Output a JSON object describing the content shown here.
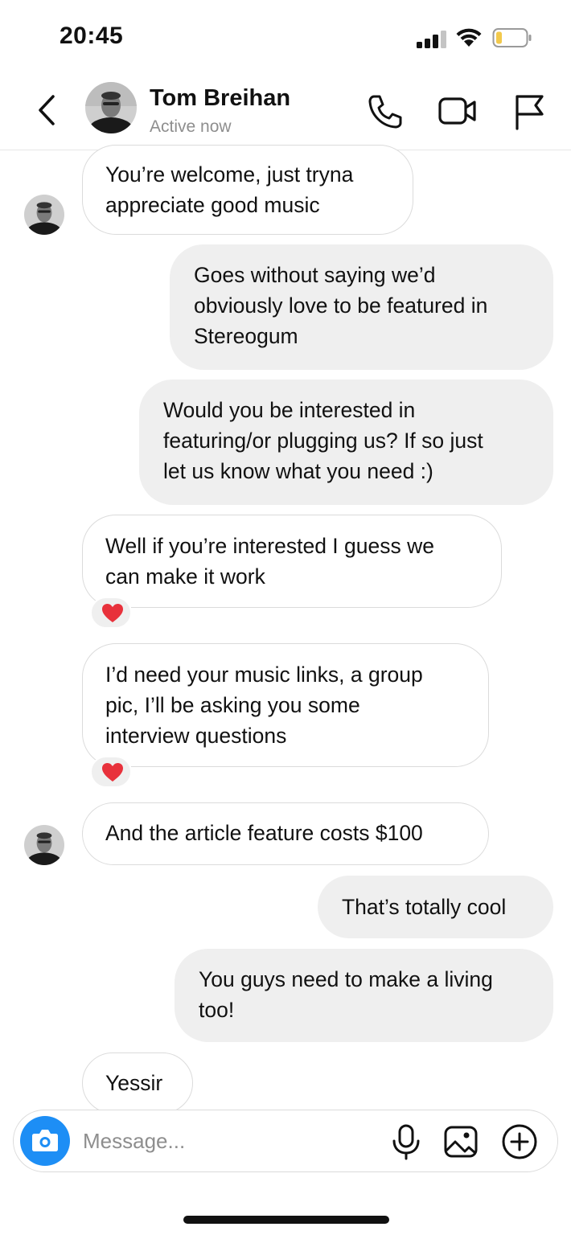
{
  "status_bar": {
    "time": "20:45"
  },
  "header": {
    "contact_name": "Tom Breihan",
    "contact_status": "Active now",
    "icons": [
      "back-chevron-icon",
      "phone-icon",
      "video-camera-icon",
      "flag-icon"
    ]
  },
  "messages": [
    {
      "sender": "them",
      "text": "You’re welcome, just tryna\nappreciate good music"
    },
    {
      "sender": "me",
      "text": "Goes without saying we’d\nobviously love to be featured in\nStereogum"
    },
    {
      "sender": "me",
      "text": "Would you be interested in\nfeaturing/or plugging us? If so just\nlet us know what you need :)"
    },
    {
      "sender": "them",
      "text": "Well if you’re interested I guess we\ncan make it work",
      "reaction": "heart"
    },
    {
      "sender": "them",
      "text": "I’d need your music links, a group\npic, I’ll be asking you some\ninterview questions",
      "reaction": "heart"
    },
    {
      "sender": "them",
      "text": "And the article feature costs $100"
    },
    {
      "sender": "me",
      "text": "That’s totally cool"
    },
    {
      "sender": "me",
      "text": "You guys need to make a living\ntoo!"
    },
    {
      "sender": "them",
      "text": "Yessir"
    }
  ],
  "composer": {
    "placeholder": "Message...",
    "icons": [
      "camera-icon",
      "microphone-icon",
      "image-icon",
      "plus-circle-icon"
    ]
  },
  "colors": {
    "accent": "#1d8ef5",
    "outgoing_bubble": "#efefef",
    "incoming_border": "#dbdbdb",
    "reaction_heart": "#e8313b",
    "secondary_text": "#8e8e8e"
  }
}
